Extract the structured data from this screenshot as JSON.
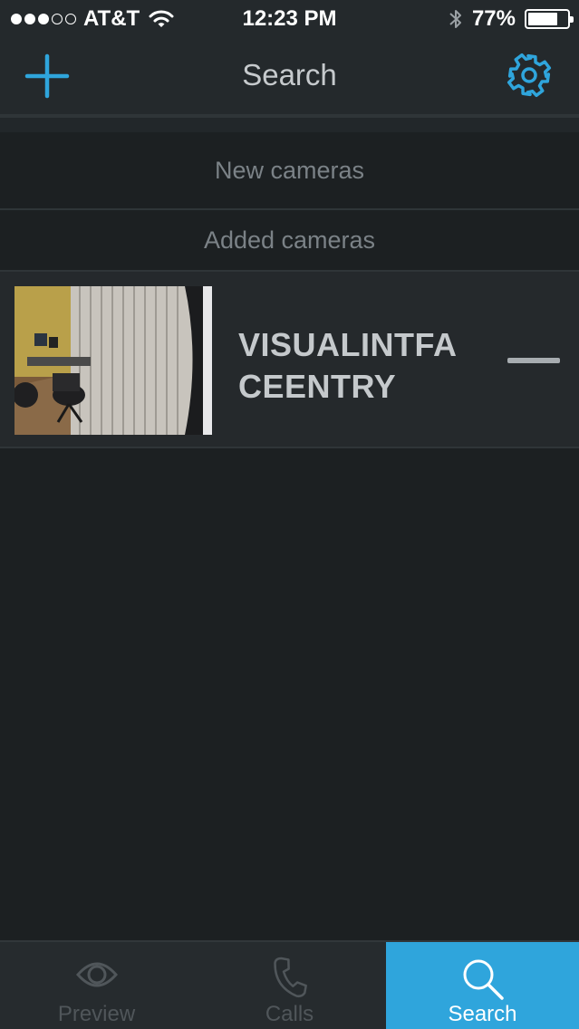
{
  "status_bar": {
    "carrier": "AT&T",
    "time": "12:23 PM",
    "battery": "77%",
    "battery_level": 0.77,
    "signal_bars_filled": 3,
    "signal_bars_total": 5
  },
  "nav": {
    "title": "Search",
    "add_icon": "plus-icon",
    "settings_icon": "gear-icon",
    "accent_color": "#2fa5dc"
  },
  "sections": {
    "new_cameras": "New cameras",
    "added_cameras": "Added cameras"
  },
  "cameras": [
    {
      "name": "VISUALINTFA CEENTRY",
      "name_line1": "VISUALINTFA",
      "name_line2": "CEENTRY",
      "action_icon": "minus-icon"
    }
  ],
  "tabs": [
    {
      "label": "Preview",
      "icon": "eye-icon",
      "active": false
    },
    {
      "label": "Calls",
      "icon": "phone-icon",
      "active": false
    },
    {
      "label": "Search",
      "icon": "search-icon",
      "active": true
    }
  ]
}
